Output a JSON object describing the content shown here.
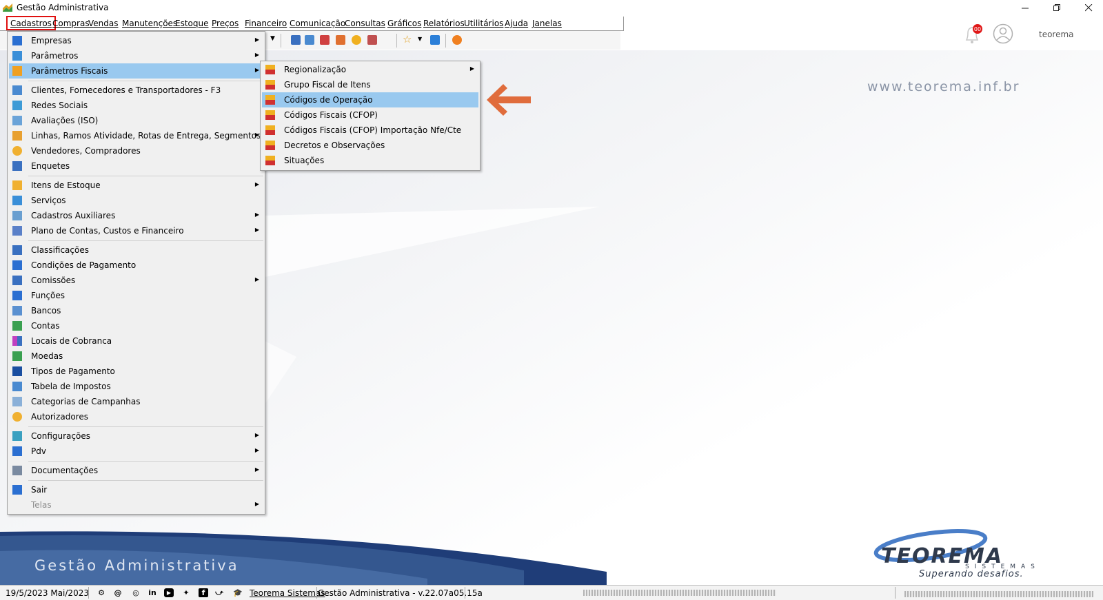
{
  "window": {
    "title": "Gestão Administrativa"
  },
  "menubar": [
    "Cadastros",
    "Compras",
    "Vendas",
    "Manutenções",
    "Estoque",
    "Preços",
    "Financeiro",
    "Comunicação",
    "Consultas",
    "Gráficos",
    "Relatórios",
    "Utilitários",
    "Ajuda",
    "Janelas"
  ],
  "header": {
    "notification_count": "00",
    "username": "teorema"
  },
  "workspace": {
    "website": "www.teorema.inf.br",
    "banner_title": "Gestão Administrativa",
    "logo": "TEOREMA",
    "logo_sub": "SISTEMAS",
    "logo_slogan": "Superando desafios."
  },
  "cadastros_menu": [
    {
      "label": "Empresas",
      "submenu": true,
      "icon": "building-icon",
      "color": "#2b6fd1"
    },
    {
      "label": "Parâmetros",
      "submenu": true,
      "icon": "grid-icon",
      "color": "#3a8fd8"
    },
    {
      "label": "Parâmetros Fiscais",
      "submenu": true,
      "icon": "tax-icon",
      "color": "#f0a020",
      "highlighted": true
    },
    {
      "label": "Clientes, Fornecedores e Transportadores - F3",
      "submenu": false,
      "icon": "users-icon",
      "color": "#4a8ad0"
    },
    {
      "label": "Redes Sociais",
      "submenu": false,
      "icon": "network-icon",
      "color": "#3d9bd6"
    },
    {
      "label": "Avaliações (ISO)",
      "submenu": false,
      "icon": "table-icon",
      "color": "#6aa3d8"
    },
    {
      "label": "Linhas, Ramos Atividade, Rotas de Entrega, Segmentos",
      "submenu": true,
      "icon": "tree-icon",
      "color": "#e8a030"
    },
    {
      "label": "Vendedores, Compradores",
      "submenu": false,
      "icon": "person-icon",
      "color": "#f0b030"
    },
    {
      "label": "Enquetes",
      "submenu": false,
      "icon": "list-icon",
      "color": "#3a70c0"
    },
    {
      "label": "Itens de Estoque",
      "submenu": true,
      "icon": "box-icon",
      "color": "#f0b030"
    },
    {
      "label": "Serviços",
      "submenu": false,
      "icon": "service-icon",
      "color": "#3a8fd8"
    },
    {
      "label": "Cadastros Auxiliares",
      "submenu": true,
      "icon": "aux-icon",
      "color": "#6a9fd0"
    },
    {
      "label": "Plano de Contas, Custos e Financeiro",
      "submenu": true,
      "icon": "ledger-icon",
      "color": "#5a80c8"
    },
    {
      "label": "Classificações",
      "submenu": false,
      "icon": "sort-icon",
      "color": "#3a70c0"
    },
    {
      "label": "Condições de Pagamento",
      "submenu": false,
      "icon": "dollar-icon",
      "color": "#2b6fd1"
    },
    {
      "label": "Comissões",
      "submenu": true,
      "icon": "commission-icon",
      "color": "#3a70c0"
    },
    {
      "label": "Funções",
      "submenu": false,
      "icon": "function-icon",
      "color": "#2b6fd1"
    },
    {
      "label": "Bancos",
      "submenu": false,
      "icon": "bank-icon",
      "color": "#5a90d0"
    },
    {
      "label": "Contas",
      "submenu": false,
      "icon": "money-icon",
      "color": "#3aa050"
    },
    {
      "label": "Locais de Cobranca",
      "submenu": false,
      "icon": "blocks-icon",
      "color": "#c040c0"
    },
    {
      "label": "Moedas",
      "submenu": false,
      "icon": "coins-icon",
      "color": "#3aa050"
    },
    {
      "label": "Tipos de Pagamento",
      "submenu": false,
      "icon": "card-icon",
      "color": "#1a4ea0"
    },
    {
      "label": "Tabela de Impostos",
      "submenu": false,
      "icon": "tax-table-icon",
      "color": "#4a8ad0"
    },
    {
      "label": "Categorias de Campanhas",
      "submenu": false,
      "icon": "category-icon",
      "color": "#8ab0d8"
    },
    {
      "label": "Autorizadores",
      "submenu": false,
      "icon": "authorizer-icon",
      "color": "#f0b030"
    },
    {
      "label": "Configurações",
      "submenu": true,
      "icon": "config-icon",
      "color": "#3aa0c0"
    },
    {
      "label": "Pdv",
      "submenu": true,
      "icon": "monitor-icon",
      "color": "#2b6fd1"
    },
    {
      "label": "Documentações",
      "submenu": true,
      "icon": "document-icon",
      "color": "#7a8aa0"
    },
    {
      "label": "Sair",
      "submenu": false,
      "icon": "exit-icon",
      "color": "#2b6fd1"
    },
    {
      "label": "Telas",
      "submenu": true,
      "icon": "",
      "color": "",
      "disabled": true
    }
  ],
  "fiscal_submenu": [
    {
      "label": "Regionalização",
      "submenu": true
    },
    {
      "label": "Grupo Fiscal de Itens",
      "submenu": false
    },
    {
      "label": "Códigos de Operação",
      "submenu": false,
      "highlighted": true
    },
    {
      "label": "Códigos Fiscais (CFOP)",
      "submenu": false
    },
    {
      "label": "Códigos Fiscais (CFOP)  Importação Nfe/Cte",
      "submenu": false
    },
    {
      "label": "Decretos e Observações",
      "submenu": false
    },
    {
      "label": "Situações",
      "submenu": false
    }
  ],
  "statusbar": {
    "date": "19/5/2023 Mai/2023",
    "company_link": "Teorema Sistemas",
    "version": "Gestão Administrativa - v.22.07a05.15a"
  },
  "colors": {
    "highlight": "#99c9ef",
    "arrow": "#e06c3c",
    "red_outline": "#e01010"
  }
}
